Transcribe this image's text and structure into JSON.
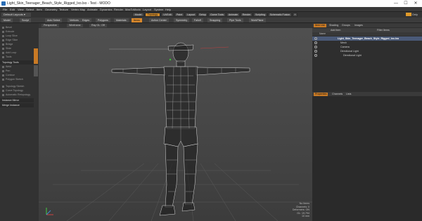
{
  "window": {
    "title": "Light_Skin_Teenager_Beach_Style_Rigged_lxo.lxo - Test - MODO",
    "controls": [
      "—",
      "☐",
      "✕"
    ]
  },
  "menu": [
    "File",
    "Edit",
    "View",
    "Select",
    "Item",
    "Geometry",
    "Texture",
    "Vertex Map",
    "Animate",
    "Dynamics",
    "Render",
    "MaxToModo",
    "Layout",
    "System",
    "Help"
  ],
  "layout": {
    "dropdown": "Default Layouts ▾",
    "tabs": [
      "Model",
      "Topology",
      "UVEdit",
      "Paint",
      "Layout",
      "Setup",
      "Game Tools",
      "Animate",
      "Render",
      "Scripting",
      "Schematic Fusion"
    ],
    "active_tab": "Topology",
    "add_tab": "+",
    "right_label": "Only"
  },
  "toolbar": {
    "items": [
      "Model",
      "Sculpt",
      "Auto Select",
      "Vertices",
      "Edges",
      "Polygons",
      "Materials",
      "Items",
      "Action Center",
      "Symmetry",
      "Falloff",
      "Snapping",
      "Pipe Tools",
      "WorkPlane"
    ],
    "active": "Items"
  },
  "left_panel": {
    "tools": [
      "Bevel",
      "Extrude",
      "Loop Slice",
      "Edge Slice",
      "Bridge",
      "Slide",
      "Add Loop",
      "Tools"
    ],
    "sections": [
      "Topology Tools",
      "Weld",
      "Pen",
      "Contour",
      "Polygon Sketch"
    ],
    "bottom_tools": [
      "Topology Sketch",
      "Curve Topology",
      "Automatic Retopology"
    ],
    "bottom_sections": [
      "Instance Mirror",
      "Merge Instance"
    ]
  },
  "viewport": {
    "tabs": [
      "Perspective",
      "Wireframe",
      "Ray GL: Off"
    ],
    "info": [
      "No Items",
      "Channels: 0",
      "Deformers: ON",
      "GL: 19,794",
      "10 mm"
    ]
  },
  "right_panel": {
    "tabs": [
      "Item List",
      "Shading",
      "Groups",
      "Images"
    ],
    "active_tab": "Item List",
    "add_item": "Add Item",
    "filter_items": "Filter Items",
    "column": "Name",
    "items": [
      {
        "label": "Light_Skin_Teenager_Beach_Style_Rigged_lxo.lxo",
        "selected": true,
        "indent": 0
      },
      {
        "label": "Mesh",
        "selected": false,
        "indent": 1
      },
      {
        "label": "Camera",
        "selected": false,
        "indent": 1
      },
      {
        "label": "Directional Light",
        "selected": false,
        "indent": 1
      },
      {
        "label": "Directional Light",
        "selected": false,
        "indent": 2
      }
    ],
    "lower_tabs": [
      "Properties",
      "Channels",
      "Lists"
    ],
    "lower_active": "Properties"
  },
  "colors": {
    "accent": "#d9882c",
    "selection": "#4a5a78",
    "wireframe": "#e8e8e8"
  }
}
